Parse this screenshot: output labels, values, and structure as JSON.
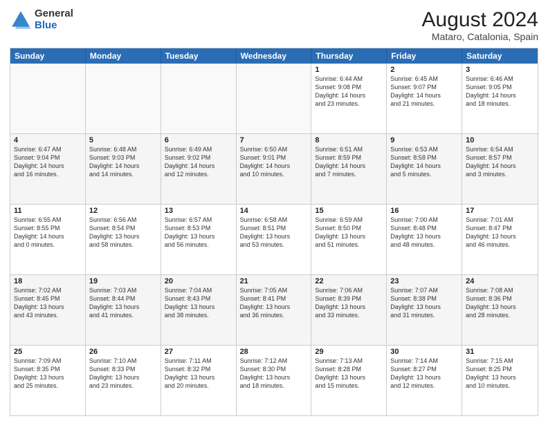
{
  "logo": {
    "general": "General",
    "blue": "Blue"
  },
  "title": {
    "month_year": "August 2024",
    "location": "Mataro, Catalonia, Spain"
  },
  "header_days": [
    "Sunday",
    "Monday",
    "Tuesday",
    "Wednesday",
    "Thursday",
    "Friday",
    "Saturday"
  ],
  "rows": [
    [
      {
        "day": "",
        "info": "",
        "empty": true
      },
      {
        "day": "",
        "info": "",
        "empty": true
      },
      {
        "day": "",
        "info": "",
        "empty": true
      },
      {
        "day": "",
        "info": "",
        "empty": true
      },
      {
        "day": "1",
        "info": "Sunrise: 6:44 AM\nSunset: 9:08 PM\nDaylight: 14 hours\nand 23 minutes."
      },
      {
        "day": "2",
        "info": "Sunrise: 6:45 AM\nSunset: 9:07 PM\nDaylight: 14 hours\nand 21 minutes."
      },
      {
        "day": "3",
        "info": "Sunrise: 6:46 AM\nSunset: 9:05 PM\nDaylight: 14 hours\nand 18 minutes."
      }
    ],
    [
      {
        "day": "4",
        "info": "Sunrise: 6:47 AM\nSunset: 9:04 PM\nDaylight: 14 hours\nand 16 minutes."
      },
      {
        "day": "5",
        "info": "Sunrise: 6:48 AM\nSunset: 9:03 PM\nDaylight: 14 hours\nand 14 minutes."
      },
      {
        "day": "6",
        "info": "Sunrise: 6:49 AM\nSunset: 9:02 PM\nDaylight: 14 hours\nand 12 minutes."
      },
      {
        "day": "7",
        "info": "Sunrise: 6:50 AM\nSunset: 9:01 PM\nDaylight: 14 hours\nand 10 minutes."
      },
      {
        "day": "8",
        "info": "Sunrise: 6:51 AM\nSunset: 8:59 PM\nDaylight: 14 hours\nand 7 minutes."
      },
      {
        "day": "9",
        "info": "Sunrise: 6:53 AM\nSunset: 8:58 PM\nDaylight: 14 hours\nand 5 minutes."
      },
      {
        "day": "10",
        "info": "Sunrise: 6:54 AM\nSunset: 8:57 PM\nDaylight: 14 hours\nand 3 minutes."
      }
    ],
    [
      {
        "day": "11",
        "info": "Sunrise: 6:55 AM\nSunset: 8:55 PM\nDaylight: 14 hours\nand 0 minutes."
      },
      {
        "day": "12",
        "info": "Sunrise: 6:56 AM\nSunset: 8:54 PM\nDaylight: 13 hours\nand 58 minutes."
      },
      {
        "day": "13",
        "info": "Sunrise: 6:57 AM\nSunset: 8:53 PM\nDaylight: 13 hours\nand 56 minutes."
      },
      {
        "day": "14",
        "info": "Sunrise: 6:58 AM\nSunset: 8:51 PM\nDaylight: 13 hours\nand 53 minutes."
      },
      {
        "day": "15",
        "info": "Sunrise: 6:59 AM\nSunset: 8:50 PM\nDaylight: 13 hours\nand 51 minutes."
      },
      {
        "day": "16",
        "info": "Sunrise: 7:00 AM\nSunset: 8:48 PM\nDaylight: 13 hours\nand 48 minutes."
      },
      {
        "day": "17",
        "info": "Sunrise: 7:01 AM\nSunset: 8:47 PM\nDaylight: 13 hours\nand 46 minutes."
      }
    ],
    [
      {
        "day": "18",
        "info": "Sunrise: 7:02 AM\nSunset: 8:45 PM\nDaylight: 13 hours\nand 43 minutes."
      },
      {
        "day": "19",
        "info": "Sunrise: 7:03 AM\nSunset: 8:44 PM\nDaylight: 13 hours\nand 41 minutes."
      },
      {
        "day": "20",
        "info": "Sunrise: 7:04 AM\nSunset: 8:43 PM\nDaylight: 13 hours\nand 38 minutes."
      },
      {
        "day": "21",
        "info": "Sunrise: 7:05 AM\nSunset: 8:41 PM\nDaylight: 13 hours\nand 36 minutes."
      },
      {
        "day": "22",
        "info": "Sunrise: 7:06 AM\nSunset: 8:39 PM\nDaylight: 13 hours\nand 33 minutes."
      },
      {
        "day": "23",
        "info": "Sunrise: 7:07 AM\nSunset: 8:38 PM\nDaylight: 13 hours\nand 31 minutes."
      },
      {
        "day": "24",
        "info": "Sunrise: 7:08 AM\nSunset: 8:36 PM\nDaylight: 13 hours\nand 28 minutes."
      }
    ],
    [
      {
        "day": "25",
        "info": "Sunrise: 7:09 AM\nSunset: 8:35 PM\nDaylight: 13 hours\nand 25 minutes."
      },
      {
        "day": "26",
        "info": "Sunrise: 7:10 AM\nSunset: 8:33 PM\nDaylight: 13 hours\nand 23 minutes."
      },
      {
        "day": "27",
        "info": "Sunrise: 7:11 AM\nSunset: 8:32 PM\nDaylight: 13 hours\nand 20 minutes."
      },
      {
        "day": "28",
        "info": "Sunrise: 7:12 AM\nSunset: 8:30 PM\nDaylight: 13 hours\nand 18 minutes."
      },
      {
        "day": "29",
        "info": "Sunrise: 7:13 AM\nSunset: 8:28 PM\nDaylight: 13 hours\nand 15 minutes."
      },
      {
        "day": "30",
        "info": "Sunrise: 7:14 AM\nSunset: 8:27 PM\nDaylight: 13 hours\nand 12 minutes."
      },
      {
        "day": "31",
        "info": "Sunrise: 7:15 AM\nSunset: 8:25 PM\nDaylight: 13 hours\nand 10 minutes."
      }
    ]
  ]
}
